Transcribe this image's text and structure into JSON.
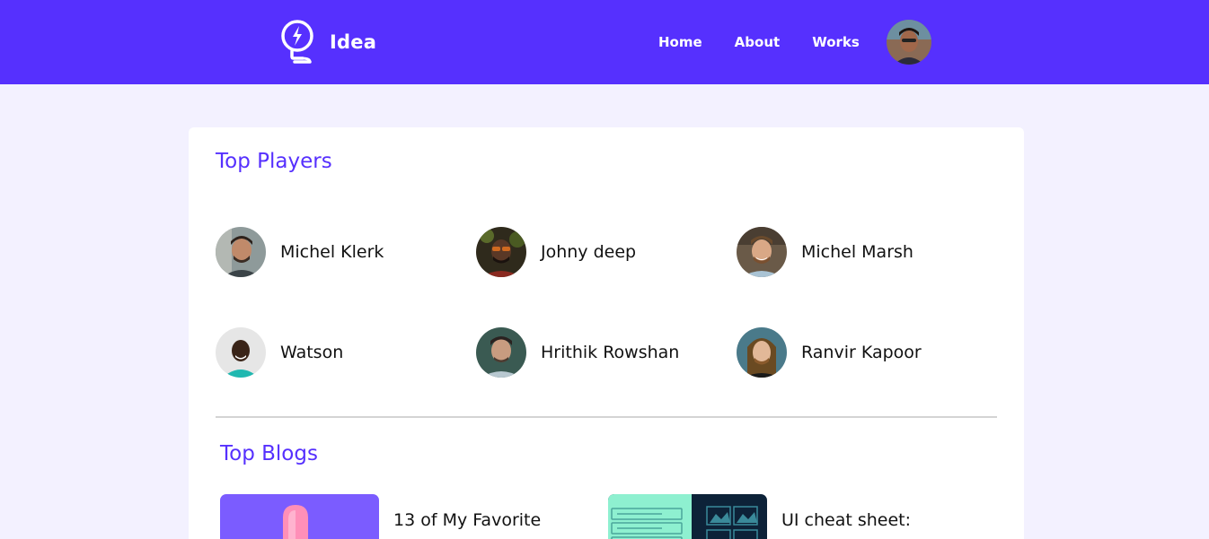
{
  "header": {
    "logo_text": "Idea",
    "nav": [
      "Home",
      "About",
      "Works"
    ],
    "bg_color": "#5630fe"
  },
  "players": {
    "title": "Top Players",
    "items": [
      {
        "name": "Michel Klerk",
        "avatar": "avatar-michel-klerk"
      },
      {
        "name": "Johny deep",
        "avatar": "avatar-johny-deep"
      },
      {
        "name": "Michel Marsh",
        "avatar": "avatar-michel-marsh"
      },
      {
        "name": "Watson",
        "avatar": "avatar-watson"
      },
      {
        "name": "Hrithik Rowshan",
        "avatar": "avatar-hrithik-rowshan"
      },
      {
        "name": "Ranvir Kapoor",
        "avatar": "avatar-ranvir-kapoor"
      }
    ]
  },
  "blogs": {
    "title": "Top Blogs",
    "items": [
      {
        "title": "13 of My Favorite"
      },
      {
        "title": "UI cheat sheet:"
      }
    ]
  },
  "colors": {
    "accent": "#5630fe",
    "page_bg": "#f3f1ff"
  }
}
